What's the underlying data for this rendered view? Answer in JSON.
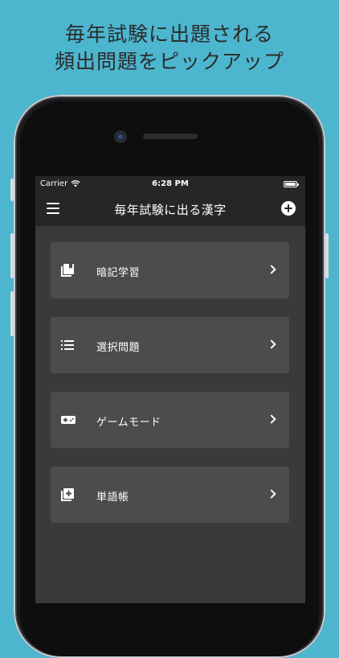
{
  "headline": {
    "line1": "毎年試験に出題される",
    "line2": "頻出問題をピックアップ"
  },
  "status_bar": {
    "carrier": "Carrier",
    "time": "6:28 PM"
  },
  "navbar": {
    "title": "毎年試験に出る漢字",
    "left_icon": "hamburger-menu-icon",
    "right_icon": "plus-circle-icon"
  },
  "menu": {
    "items": [
      {
        "label": "暗記学習",
        "icon": "flashcards-icon"
      },
      {
        "label": "選択問題",
        "icon": "list-icon"
      },
      {
        "label": "ゲームモード",
        "icon": "gamepad-icon"
      },
      {
        "label": "単語帳",
        "icon": "add-to-library-icon"
      }
    ]
  },
  "colors": {
    "background": "#4db6cf",
    "screen": "#3a3a3a",
    "navbar": "#262626",
    "card": "#4c4c4c"
  }
}
